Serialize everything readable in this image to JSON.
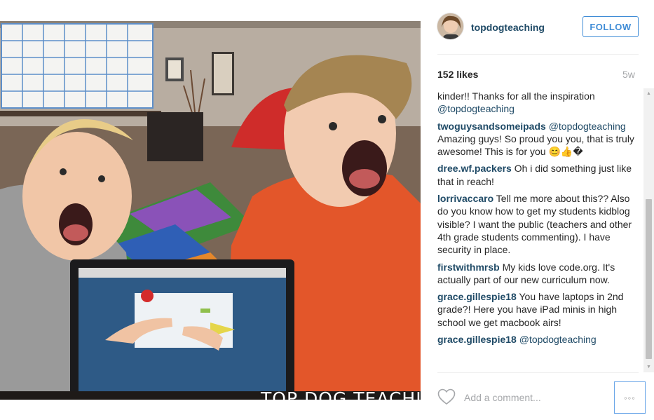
{
  "post": {
    "watermark": "TOP DOG TEACHING",
    "likes": "152 likes",
    "time": "5w"
  },
  "header": {
    "username": "topdogteaching",
    "follow_label": "FOLLOW"
  },
  "comments": [
    {
      "author": "",
      "text": "kinder!! Thanks for all the inspiration ",
      "mention": "@topdogteaching"
    },
    {
      "author": "twoguysandsomeipads",
      "text": " Amazing guys! So proud you you, that is truly awesome! This is for you 😊👍�",
      "mention_prefix": " @topdogteaching"
    },
    {
      "author": "dree.wf.packers",
      "text": " Oh i did something just like that in reach!"
    },
    {
      "author": "lorrivaccaro",
      "text": " Tell me more about this?? Also do you know how to get my students kidblog visible? I want the public (teachers and other 4th grade students commenting). I have security in place."
    },
    {
      "author": "firstwithmrsb",
      "text": " My kids love code.org. It's actually part of our new curriculum now."
    },
    {
      "author": "grace.gillespie18",
      "text": " You have laptops in 2nd grade?! Here you have iPad minis in high school we get macbook airs!"
    },
    {
      "author": "grace.gillespie18",
      "text": " ",
      "mention": "@topdogteaching"
    }
  ],
  "footer": {
    "comment_placeholder": "Add a comment...",
    "more_label": "◦◦◦"
  },
  "scrollbar": {
    "up_glyph": "▲",
    "down_glyph": "▼"
  },
  "colors": {
    "link": "#1f4a66",
    "follow": "#3f8cd6",
    "muted": "#a5a7aa"
  },
  "icons": [
    "heart-icon",
    "more-options-icon"
  ]
}
